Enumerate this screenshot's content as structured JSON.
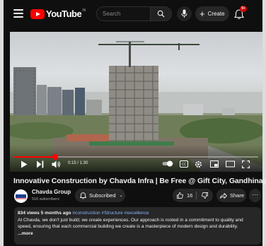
{
  "header": {
    "logo_text": "YouTube",
    "logo_tm": "IN",
    "search_placeholder": "Search",
    "create_label": "Create",
    "notifications_badge": "9+"
  },
  "player": {
    "time": "0:15 / 1:30",
    "progress_fraction": 0.167
  },
  "video": {
    "title": "Innovative Construction by Chavda Infra | Be Free @ Gift City, Gandhinagar"
  },
  "channel": {
    "name": "Chavda Group",
    "subscribers": "516 subscribers",
    "subscribed_label": "Subscribed"
  },
  "actions": {
    "likes": "16",
    "share_label": "Share",
    "more_label": "···"
  },
  "description": {
    "views": "834 views",
    "age": "5 months ago",
    "tags": "#construction #Structure #excellence",
    "text": "At Chavda, we don't just build; we create experiences. Our approach is rooted in a commitment to quality and speed, ensuring that each commercial building we create is a masterpiece of modern design and durability.",
    "more_label": "...more"
  },
  "colors": {
    "brand_red": "#ff0000",
    "background": "#0f0f0f",
    "button_bg": "#272727",
    "hashtag_blue": "#8ab4f8"
  }
}
